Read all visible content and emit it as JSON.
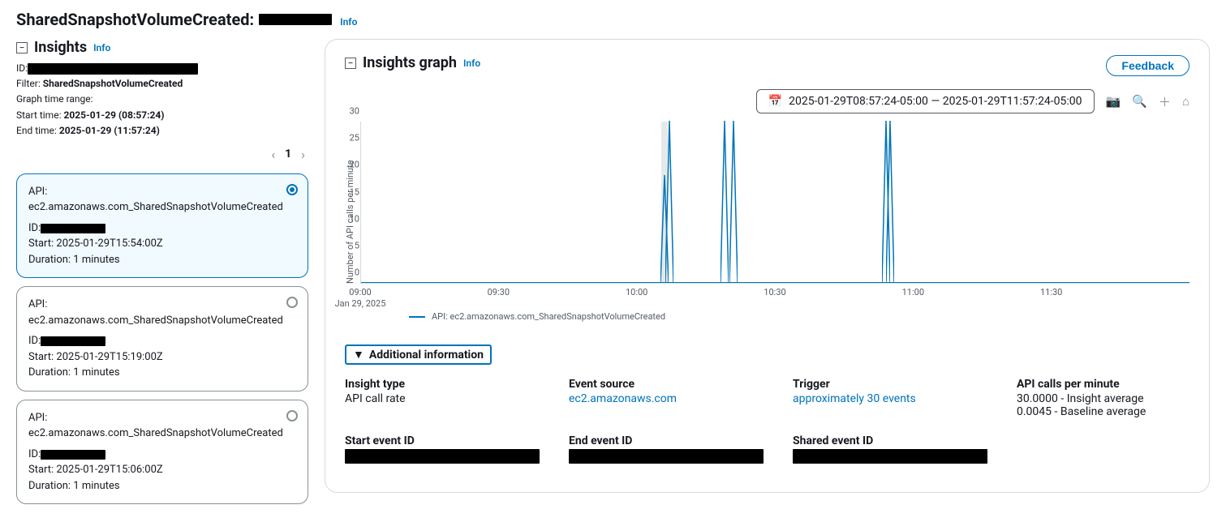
{
  "header": {
    "title_prefix": "SharedSnapshotVolumeCreated:",
    "info": "Info"
  },
  "insights_panel": {
    "title": "Insights",
    "info": "Info",
    "id_label": "ID:",
    "filter_label": "Filter:",
    "filter_value": "SharedSnapshotVolumeCreated",
    "range_label": "Graph time range:",
    "start_label": "Start time:",
    "start_value": "2025-01-29 (08:57:24)",
    "end_label": "End time:",
    "end_value": "2025-01-29 (11:57:24)",
    "page": "1"
  },
  "cards": [
    {
      "api_label": "API:",
      "api": "ec2.amazonaws.com_SharedSnapshotVolumeCreated",
      "id_label": "ID:",
      "start_label": "Start:",
      "start": "2025-01-29T15:54:00Z",
      "dur_label": "Duration:",
      "dur": "1 minutes",
      "selected": true
    },
    {
      "api_label": "API:",
      "api": "ec2.amazonaws.com_SharedSnapshotVolumeCreated",
      "id_label": "ID:",
      "start_label": "Start:",
      "start": "2025-01-29T15:19:00Z",
      "dur_label": "Duration:",
      "dur": "1 minutes",
      "selected": false
    },
    {
      "api_label": "API:",
      "api": "ec2.amazonaws.com_SharedSnapshotVolumeCreated",
      "id_label": "ID:",
      "start_label": "Start:",
      "start": "2025-01-29T15:06:00Z",
      "dur_label": "Duration:",
      "dur": "1 minutes",
      "selected": false
    }
  ],
  "graph": {
    "title": "Insights graph",
    "info": "Info",
    "feedback": "Feedback",
    "time_range": "2025-01-29T08:57:24-05:00 — 2025-01-29T11:57:24-05:00",
    "ylabel": "Number of API calls per minute",
    "legend": "API: ec2.amazonaws.com_SharedSnapshotVolumeCreated",
    "x_date": "Jan 29, 2025"
  },
  "chart_data": {
    "type": "line",
    "title": "Insights graph",
    "xlabel": "",
    "ylabel": "Number of API calls per minute",
    "ylim": [
      0,
      30
    ],
    "y_ticks": [
      0,
      5,
      10,
      15,
      20,
      25,
      30
    ],
    "x_ticks": [
      "09:00",
      "09:30",
      "10:00",
      "10:30",
      "11:00",
      "11:30"
    ],
    "x_range_minutes": [
      0,
      180
    ],
    "series": [
      {
        "name": "API: ec2.amazonaws.com_SharedSnapshotVolumeCreated",
        "spikes": [
          {
            "x_min": 66,
            "value": 20,
            "highlighted": true
          },
          {
            "x_min": 67,
            "value": 30
          },
          {
            "x_min": 79,
            "value": 30
          },
          {
            "x_min": 81,
            "value": 30
          },
          {
            "x_min": 114,
            "value": 30
          },
          {
            "x_min": 115,
            "value": 30
          }
        ]
      }
    ]
  },
  "additional": {
    "title": "Additional information",
    "rows": [
      [
        {
          "label": "Insight type",
          "value": "API call rate"
        },
        {
          "label": "Event source",
          "link": "ec2.amazonaws.com"
        },
        {
          "label": "Trigger",
          "link": "approximately 30 events"
        },
        {
          "label": "API calls per minute",
          "value": "30.0000 - Insight average",
          "value2": "0.0045 - Baseline average"
        }
      ],
      [
        {
          "label": "Start event ID",
          "redacted": true
        },
        {
          "label": "End event ID",
          "redacted": true
        },
        {
          "label": "Shared event ID",
          "redacted": true
        },
        {}
      ]
    ]
  }
}
